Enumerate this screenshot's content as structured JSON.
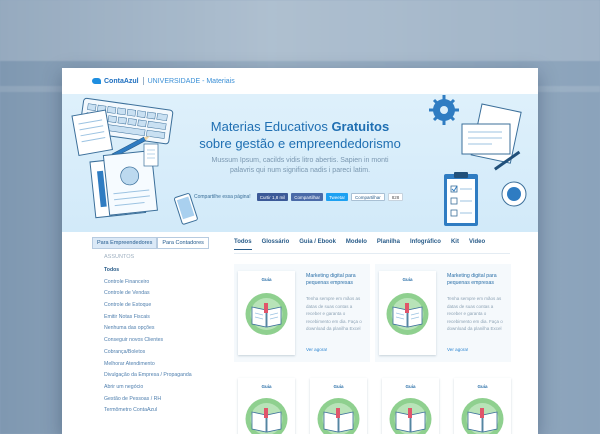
{
  "header": {
    "logo_text": "ContaAzul",
    "section": "UNIVERSIDADE - Materiais"
  },
  "hero": {
    "title_regular": "Materias Educativos ",
    "title_bold": "Gratuitos",
    "title_line2": "sobre gestão e empreendedorismo",
    "subtitle": "Mussum Ipsum, cacilds vidis litro abertis. Sapien in monti palavris qui num significa nadis i pareci latim.",
    "share_label": "Compartilhe essa página!",
    "share_buttons": {
      "facebook_like": "Curtir 1,8 mil",
      "facebook_share": "Compartilhar",
      "twitter": "Tweetar",
      "linkedin": "Compartilhar",
      "count": "828"
    }
  },
  "sidebar": {
    "tabs": [
      "Para Empreendedores",
      "Para Contadores"
    ],
    "section_label": "ASSUNTOS",
    "items": [
      "Todos",
      "Controle Financeiro",
      "Controle de Vendas",
      "Controle de Estoque",
      "Emitir Notas Fiscais",
      "Nenhuma das opções",
      "Conseguir novos Clientes",
      "Cobrança/Boletos",
      "Melhorar Atendimento",
      "Divulgação da Empresa / Propaganda",
      "Abrir um negócio",
      "Gestão de Pessoas / RH",
      "Termômetro ContaAzul"
    ]
  },
  "content_tabs": [
    "Todos",
    "Glossário",
    "Guia / Ebook",
    "Modelo",
    "Planilha",
    "Infográfico",
    "Kit",
    "Video"
  ],
  "materials": [
    {
      "tag": "Guia",
      "title": "Marketing digital para pequenas empresas",
      "description": "Tenha sempre em mãos as datas de suas contas a receber e garanta o recebimento em dia. Faça o download da planilha Excel",
      "link": "Ver agora!"
    },
    {
      "tag": "Guia",
      "title": "Marketing digital para pequenas empresas",
      "description": "Tenha sempre em mãos as datas de suas contas a receber e garanta o recebimento em dia. Faça o download da planilha Excel",
      "link": "Ver agora!"
    }
  ],
  "row2_tags": [
    "Guia",
    "Guia",
    "Guia",
    "Guia"
  ],
  "colors": {
    "accent": "#1f6fb2",
    "hero_bg": "#d7ecfa",
    "badge_green": "#7bc67b"
  }
}
